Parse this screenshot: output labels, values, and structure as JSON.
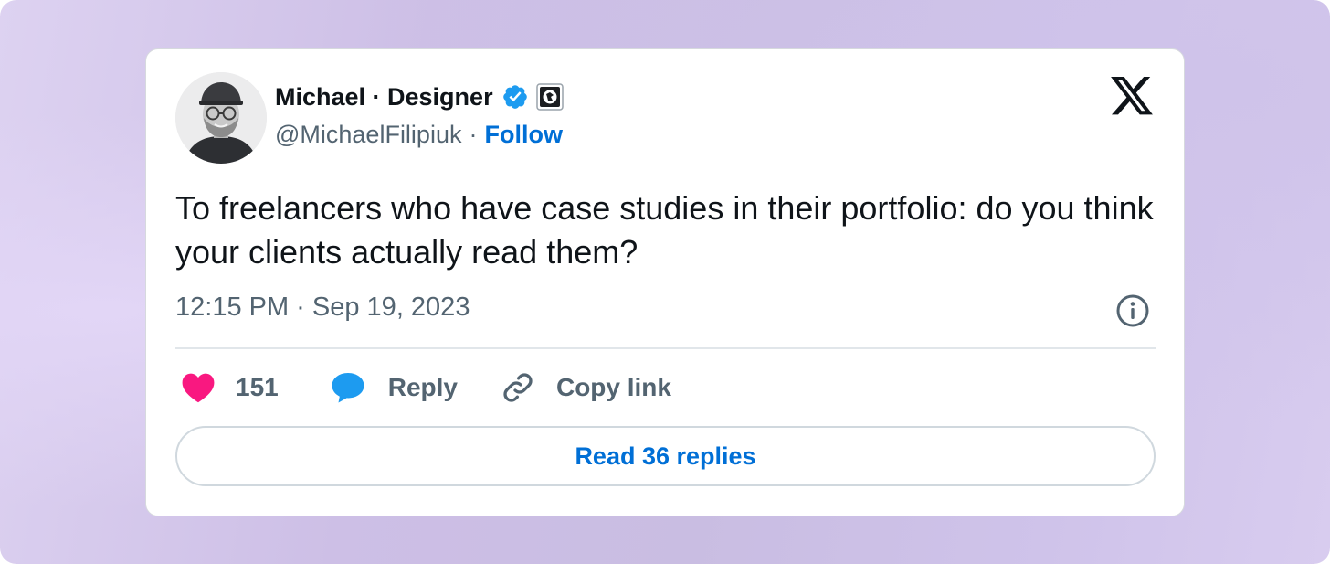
{
  "author": {
    "display_name": "Michael · Designer",
    "handle": "@MichaelFilipiuk",
    "separator": "·",
    "follow_label": "Follow"
  },
  "tweet": {
    "text": "To freelancers who have case studies in their portfolio: do you think your clients actually read them?",
    "timestamp": "12:15 PM · Sep 19, 2023"
  },
  "actions": {
    "like_count": "151",
    "reply_label": "Reply",
    "copy_link_label": "Copy link"
  },
  "read_replies_label": "Read 36 replies",
  "icons": {
    "avatar": "avatar-photo",
    "verified": "verified-badge-icon",
    "affiliation": "affiliation-badge-icon",
    "brand": "x-logo-icon",
    "info": "info-icon",
    "like": "heart-icon",
    "reply": "speech-bubble-icon",
    "copy_link": "link-icon"
  },
  "colors": {
    "accent_link": "#006fd6",
    "like_heart": "#f91880",
    "reply_bubble": "#1d9bf0",
    "verified": "#1d9bf0",
    "text_primary": "#0f1419",
    "text_secondary": "#536471"
  }
}
